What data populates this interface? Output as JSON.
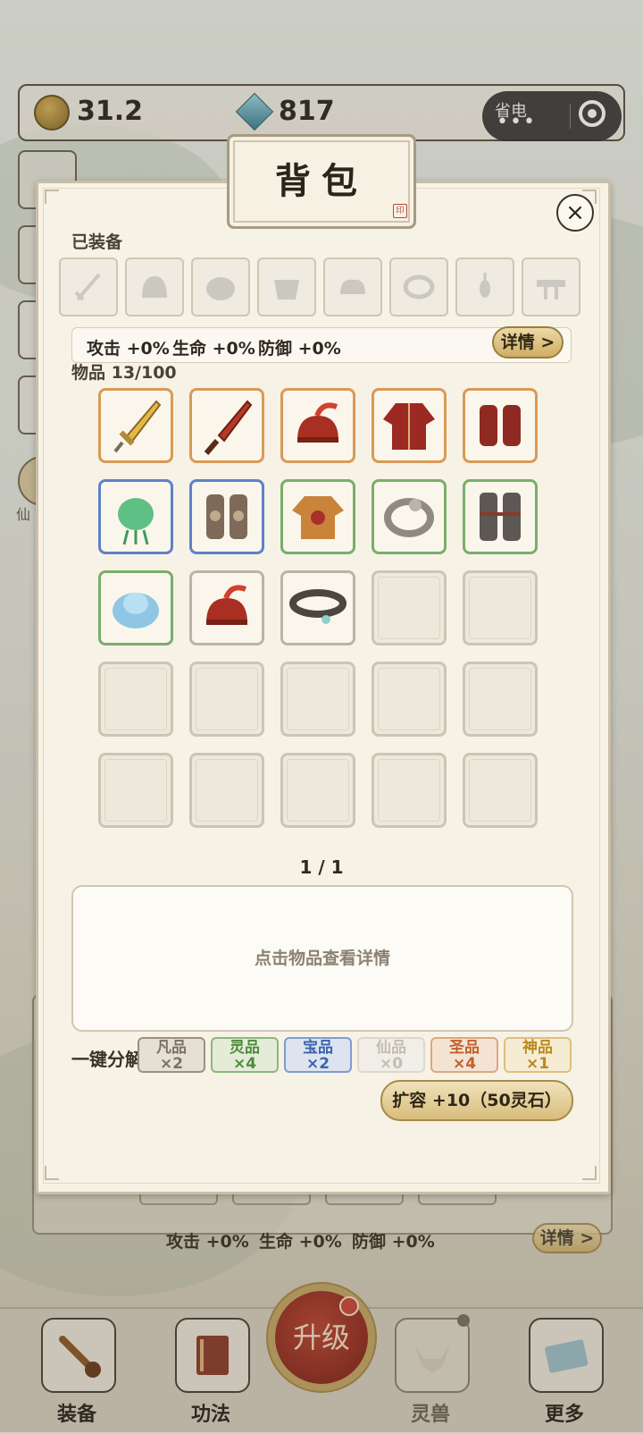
{
  "topbar": {
    "coins": "31.2",
    "gems": "817",
    "power_saving_label": "省电"
  },
  "background": {
    "stats": {
      "attack": "攻击 +0%",
      "hp": "生命 +0%",
      "defense": "防御 +0%"
    },
    "details_label": "详情 >",
    "side_label": "仙"
  },
  "bottom_nav": {
    "items": [
      {
        "label": "装备",
        "icon": "sword-icon"
      },
      {
        "label": "功法",
        "icon": "book-icon"
      },
      {
        "label": "灵兽",
        "icon": "fox-icon"
      },
      {
        "label": "更多",
        "icon": "more-icon"
      }
    ],
    "upgrade_label": "升级"
  },
  "bag": {
    "title": "背包",
    "close_label": "×",
    "equipped_label": "已装备",
    "equipped_slots": [
      "sword-slot-icon",
      "helmet-slot-icon",
      "armor-slot-icon",
      "robe-slot-icon",
      "gloves-slot-icon",
      "ring-slot-icon",
      "pendant-slot-icon",
      "belt-slot-icon"
    ],
    "stats": {
      "attack": "攻击 +0%",
      "hp": "生命 +0%",
      "defense": "防御 +0%"
    },
    "details_label": "详情 >",
    "items_label": "物品 13/100",
    "items": [
      {
        "name": "golden-sword",
        "rarity": "orange"
      },
      {
        "name": "red-sword",
        "rarity": "orange"
      },
      {
        "name": "red-helmet",
        "rarity": "orange"
      },
      {
        "name": "red-robe",
        "rarity": "orange"
      },
      {
        "name": "red-bracers",
        "rarity": "orange"
      },
      {
        "name": "jade-pendant",
        "rarity": "blue"
      },
      {
        "name": "bronze-bracers",
        "rarity": "blue"
      },
      {
        "name": "golden-robe",
        "rarity": "green"
      },
      {
        "name": "silver-ring",
        "rarity": "green"
      },
      {
        "name": "iron-greaves",
        "rarity": "green"
      },
      {
        "name": "blue-crystal",
        "rarity": "green"
      },
      {
        "name": "red-helmet",
        "rarity": "white"
      },
      {
        "name": "leather-belt",
        "rarity": "white"
      }
    ],
    "pager": "1 / 1",
    "detail_hint": "点击物品查看详情",
    "disassemble_label": "一键分解",
    "disassemble": [
      {
        "grade": "凡品",
        "count": "×2",
        "color": "#7b7264",
        "bg": "#e6e0d4",
        "border": "#9a917f"
      },
      {
        "grade": "灵品",
        "count": "×4",
        "color": "#4d8d3c",
        "bg": "#e4ecd8",
        "border": "#8cb878"
      },
      {
        "grade": "宝品",
        "count": "×2",
        "color": "#3b64ad",
        "bg": "#dde4ef",
        "border": "#7f9bcf"
      },
      {
        "grade": "仙品",
        "count": "×0",
        "color": "#c3bdb2",
        "bg": "#f1eee7",
        "border": "#ddd7cc"
      },
      {
        "grade": "圣品",
        "count": "×4",
        "color": "#c2602c",
        "bg": "#f4e3d3",
        "border": "#dfa77c"
      },
      {
        "grade": "神品",
        "count": "×1",
        "color": "#b98a1d",
        "bg": "#f6ecd3",
        "border": "#dcc07a"
      }
    ],
    "expand_label": "扩容 +10（50灵石）"
  }
}
